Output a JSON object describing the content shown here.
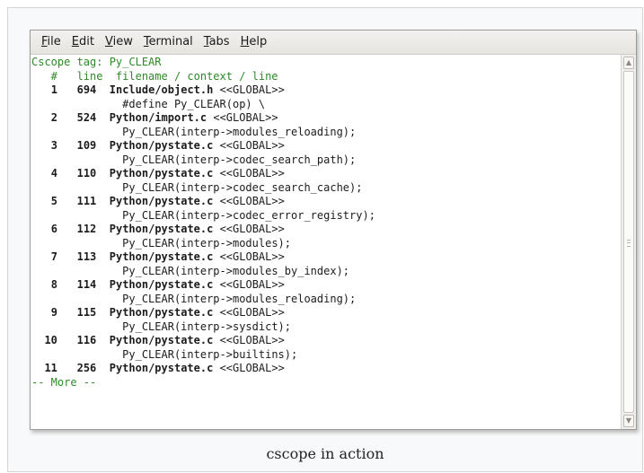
{
  "menu": {
    "items": [
      {
        "mnemonic": "F",
        "rest": "ile"
      },
      {
        "mnemonic": "E",
        "rest": "dit"
      },
      {
        "mnemonic": "V",
        "rest": "iew"
      },
      {
        "mnemonic": "T",
        "rest": "erminal"
      },
      {
        "mnemonic": "T",
        "rest": "abs"
      },
      {
        "mnemonic": "H",
        "rest": "elp"
      }
    ]
  },
  "terminal": {
    "tag_line": "Cscope tag: Py_CLEAR",
    "header_line": "   #   line  filename / context / line",
    "entries": [
      {
        "num": "1",
        "line": "694",
        "file": "Include/object.h",
        "context": "<<GLOBAL>>",
        "code": "#define Py_CLEAR(op) \\"
      },
      {
        "num": "2",
        "line": "524",
        "file": "Python/import.c",
        "context": "<<GLOBAL>>",
        "code": "Py_CLEAR(interp->modules_reloading);"
      },
      {
        "num": "3",
        "line": "109",
        "file": "Python/pystate.c",
        "context": "<<GLOBAL>>",
        "code": "Py_CLEAR(interp->codec_search_path);"
      },
      {
        "num": "4",
        "line": "110",
        "file": "Python/pystate.c",
        "context": "<<GLOBAL>>",
        "code": "Py_CLEAR(interp->codec_search_cache);"
      },
      {
        "num": "5",
        "line": "111",
        "file": "Python/pystate.c",
        "context": "<<GLOBAL>>",
        "code": "Py_CLEAR(interp->codec_error_registry);"
      },
      {
        "num": "6",
        "line": "112",
        "file": "Python/pystate.c",
        "context": "<<GLOBAL>>",
        "code": "Py_CLEAR(interp->modules);"
      },
      {
        "num": "7",
        "line": "113",
        "file": "Python/pystate.c",
        "context": "<<GLOBAL>>",
        "code": "Py_CLEAR(interp->modules_by_index);"
      },
      {
        "num": "8",
        "line": "114",
        "file": "Python/pystate.c",
        "context": "<<GLOBAL>>",
        "code": "Py_CLEAR(interp->modules_reloading);"
      },
      {
        "num": "9",
        "line": "115",
        "file": "Python/pystate.c",
        "context": "<<GLOBAL>>",
        "code": "Py_CLEAR(interp->sysdict);"
      },
      {
        "num": "10",
        "line": "116",
        "file": "Python/pystate.c",
        "context": "<<GLOBAL>>",
        "code": "Py_CLEAR(interp->builtins);"
      },
      {
        "num": "11",
        "line": "256",
        "file": "Python/pystate.c",
        "context": "<<GLOBAL>>",
        "code": ""
      }
    ],
    "more_line": "-- More --"
  },
  "scrollbar": {
    "up_icon": "arrow-up-icon",
    "down_icon": "arrow-down-icon",
    "grip_icon": "grip-icon"
  },
  "caption": "cscope in action",
  "colors": {
    "green_text": "#2d8a26",
    "terminal_bg": "#ffffff",
    "terminal_fg": "#1c1c1c"
  }
}
